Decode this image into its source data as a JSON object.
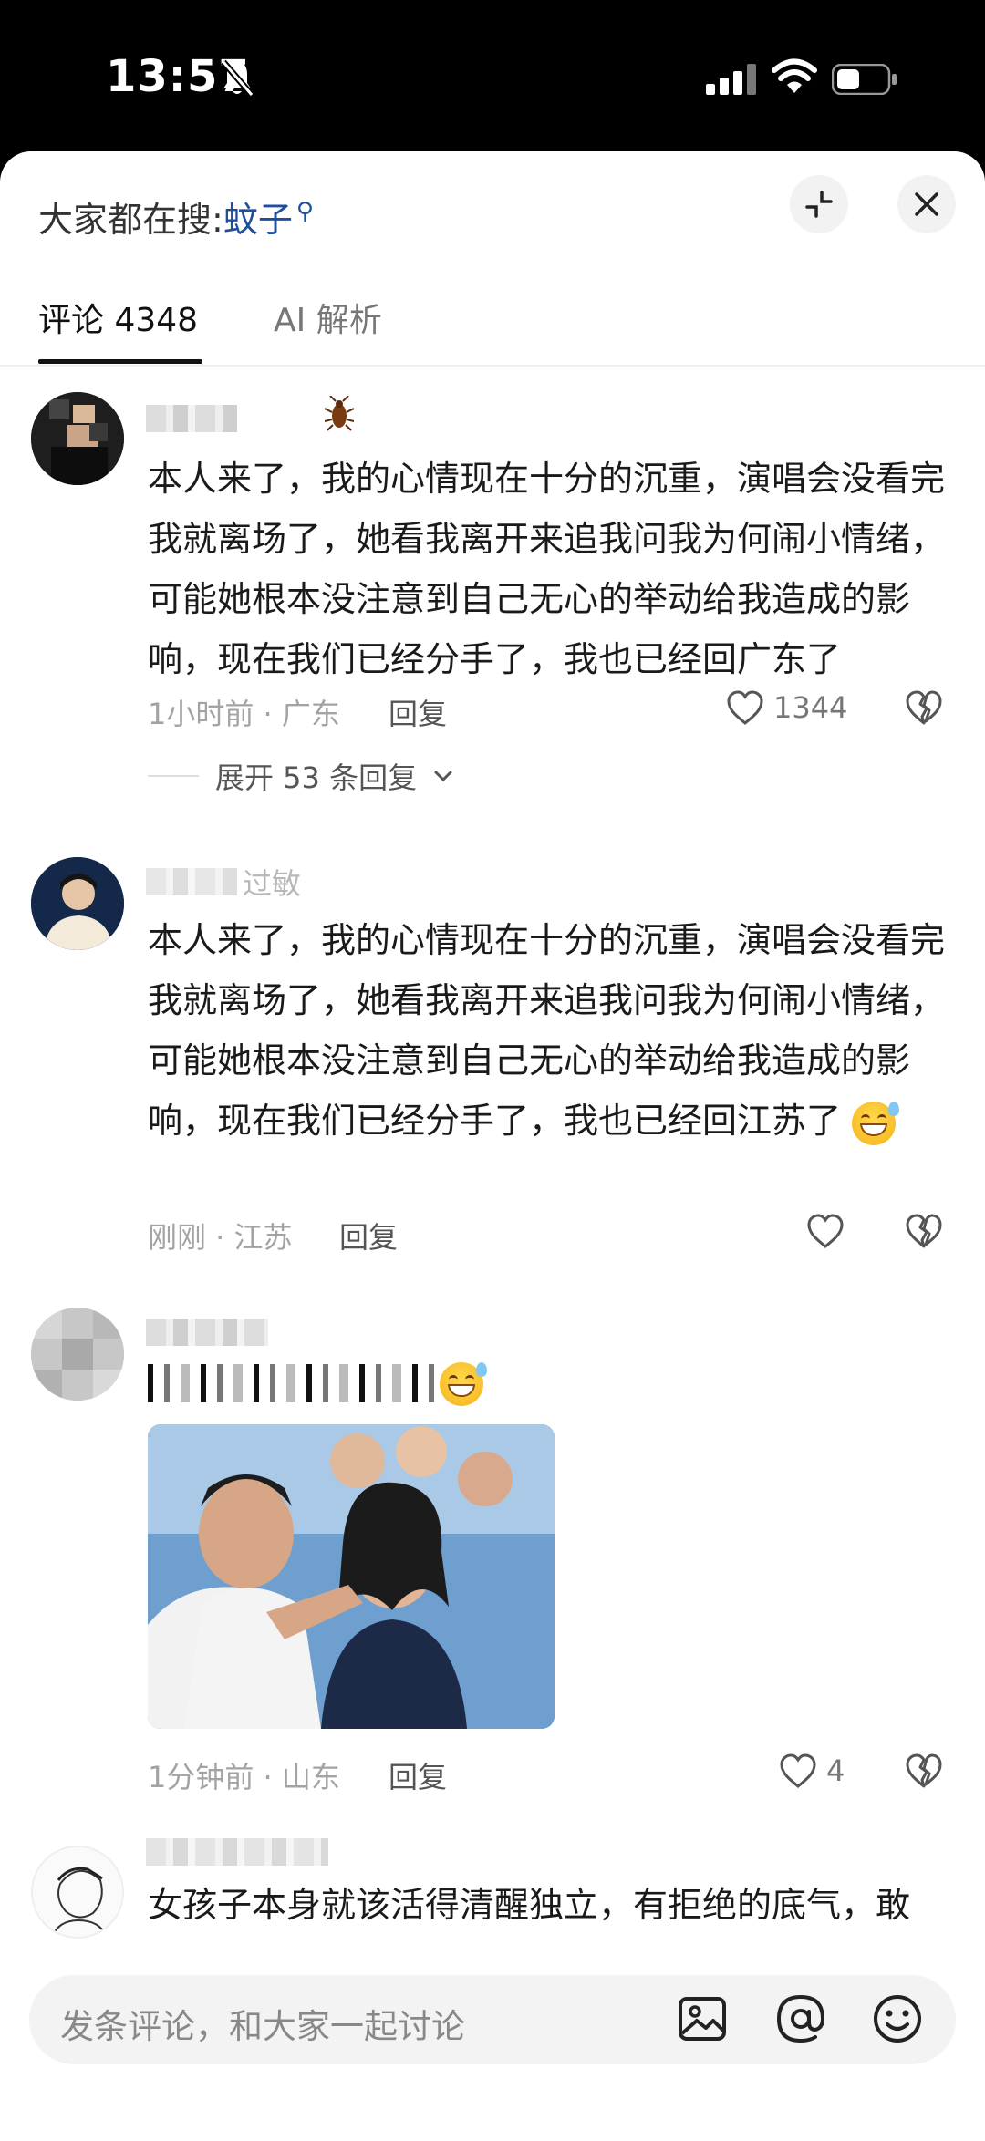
{
  "status_bar": {
    "time": "13:57"
  },
  "header": {
    "search_prefix": "大家都在搜:",
    "search_keyword": "蚊子"
  },
  "tabs": [
    {
      "label": "评论 4348",
      "active": true
    },
    {
      "label": "AI 解析",
      "active": false
    }
  ],
  "comments": [
    {
      "username": "",
      "text": "本人来了，我的心情现在十分的沉重，演唱会没看完我就离场了，她看我离开来追我问我为何闹小情绪，可能她根本没注意到自己无心的举动给我造成的影响，现在我们已经分手了，我也已经回广东了",
      "meta": "1小时前 · 广东",
      "reply": "回复",
      "likes": "1344",
      "expand": "展开 53 条回复"
    },
    {
      "username": "过敏",
      "text": "本人来了，我的心情现在十分的沉重，演唱会没看完我就离场了，她看我离开来追我问我为何闹小情绪，可能她根本没注意到自己无心的举动给我造成的影响，现在我们已经分手了，我也已经回江苏了",
      "meta": "刚刚 · 江苏",
      "reply": "回复",
      "likes": ""
    },
    {
      "username": "",
      "text": "",
      "meta": "1分钟前 · 山东",
      "reply": "回复",
      "likes": "4"
    },
    {
      "username": "",
      "text": "女孩子本身就该活得清醒独立，有拒绝的底气，敢"
    }
  ],
  "composer": {
    "placeholder": "发条评论，和大家一起讨论"
  },
  "colors": {
    "keyword": "#1f4e9c",
    "background": "#ffffff",
    "status_bar": "#000000"
  }
}
